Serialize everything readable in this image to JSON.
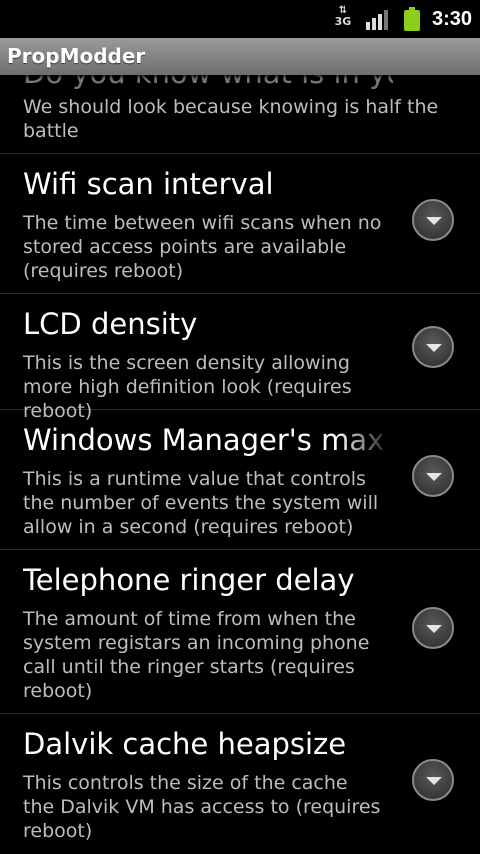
{
  "status": {
    "network_label": "3G",
    "time": "3:30"
  },
  "app": {
    "title": "PropModder"
  },
  "items": [
    {
      "title": "Do you know what is in your",
      "summary": "We should look because knowing is half the battle"
    },
    {
      "title": "Wifi scan interval",
      "summary": "The time between wifi scans when no stored access points are available (requires reboot)"
    },
    {
      "title": "LCD density",
      "summary": "This is the screen density allowing more high definition look (requires reboot)"
    },
    {
      "title": "Windows Manager's max",
      "summary": "This is a runtime value that controls the number of events the system will allow in a second (requires reboot)"
    },
    {
      "title": "Telephone ringer delay",
      "summary": "The amount of time from when the system registars an incoming phone call until the ringer starts (requires reboot)"
    },
    {
      "title": "Dalvik cache heapsize",
      "summary": "This controls the size of the cache the Dalvik VM has access to (requires reboot)"
    }
  ]
}
